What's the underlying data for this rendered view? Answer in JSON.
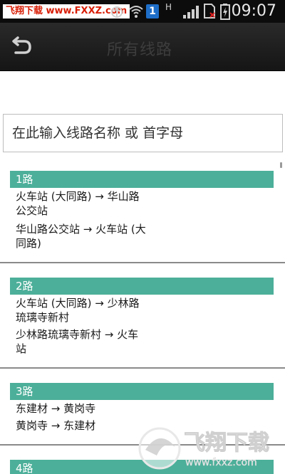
{
  "status_bar": {
    "watermark_text_red": "飞翔下载",
    "watermark_text_black": " www.FXXZ.com",
    "network_label": "H",
    "sim_badge": "1",
    "time": "09:07"
  },
  "action_bar": {
    "title": "所有线路"
  },
  "search": {
    "placeholder": "在此输入线路名称 或 首字母"
  },
  "routes": [
    {
      "name": "1路",
      "directions": [
        {
          "line1": "火车站 (大同路) → 华山路",
          "line2": "公交站"
        },
        {
          "line1": "华山路公交站 → 火车站 (大",
          "line2": "同路)"
        }
      ]
    },
    {
      "name": "2路",
      "directions": [
        {
          "line1": "火车站 (大同路) → 少林路",
          "line2": "琉璃寺新村"
        },
        {
          "line1": "少林路琉璃寺新村 → 火车",
          "line2": "站"
        }
      ]
    },
    {
      "name": "3路",
      "directions": [
        {
          "line1": "东建材 → 黄岗寺",
          "line2": ""
        },
        {
          "line1": "黄岗寺 → 东建材",
          "line2": ""
        }
      ]
    },
    {
      "name": "4路",
      "directions": []
    }
  ],
  "watermark_logo": {
    "brand_text": "飞翔下载",
    "url_text": "www.fxxz.com"
  },
  "colors": {
    "route_header_bg": "#4caf99",
    "statusbar_bg": "#0c0c0c",
    "actionbar_bg": "#1e1e1e",
    "watermark_red": "#d81e06"
  }
}
